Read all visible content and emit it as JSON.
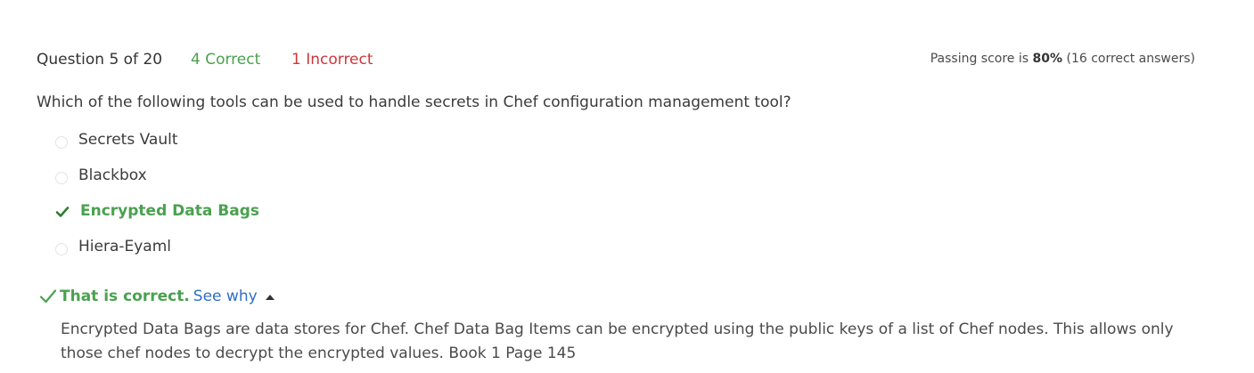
{
  "header": {
    "question_counter": "Question 5 of 20",
    "correct_count": "4 Correct",
    "incorrect_count": "1 Incorrect",
    "passing_prefix": "Passing score is ",
    "passing_percent": "80%",
    "passing_suffix": " (16 correct answers)"
  },
  "question": {
    "text": "Which of the following tools can be used to handle secrets in Chef configuration management tool?"
  },
  "options": [
    {
      "label": "Secrets Vault",
      "selected": false
    },
    {
      "label": "Blackbox",
      "selected": false
    },
    {
      "label": "Encrypted Data Bags",
      "selected": true
    },
    {
      "label": "Hiera-Eyaml",
      "selected": false
    }
  ],
  "feedback": {
    "result_label": "That is correct.",
    "see_why_label": "See why",
    "explanation": "Encrypted Data Bags are data stores for Chef. Chef Data Bag Items can be encrypted using the public keys of a list of Chef nodes. This allows only those chef nodes to decrypt the encrypted values. Book 1 Page 145"
  },
  "colors": {
    "correct": "#4aa14f",
    "incorrect": "#d0363a",
    "link": "#2f6fc6"
  },
  "icons": {
    "selected_option": "checkmark-icon",
    "unselected_option": "radio-icon",
    "feedback": "checkmark-icon",
    "toggle": "caret-up-icon"
  }
}
